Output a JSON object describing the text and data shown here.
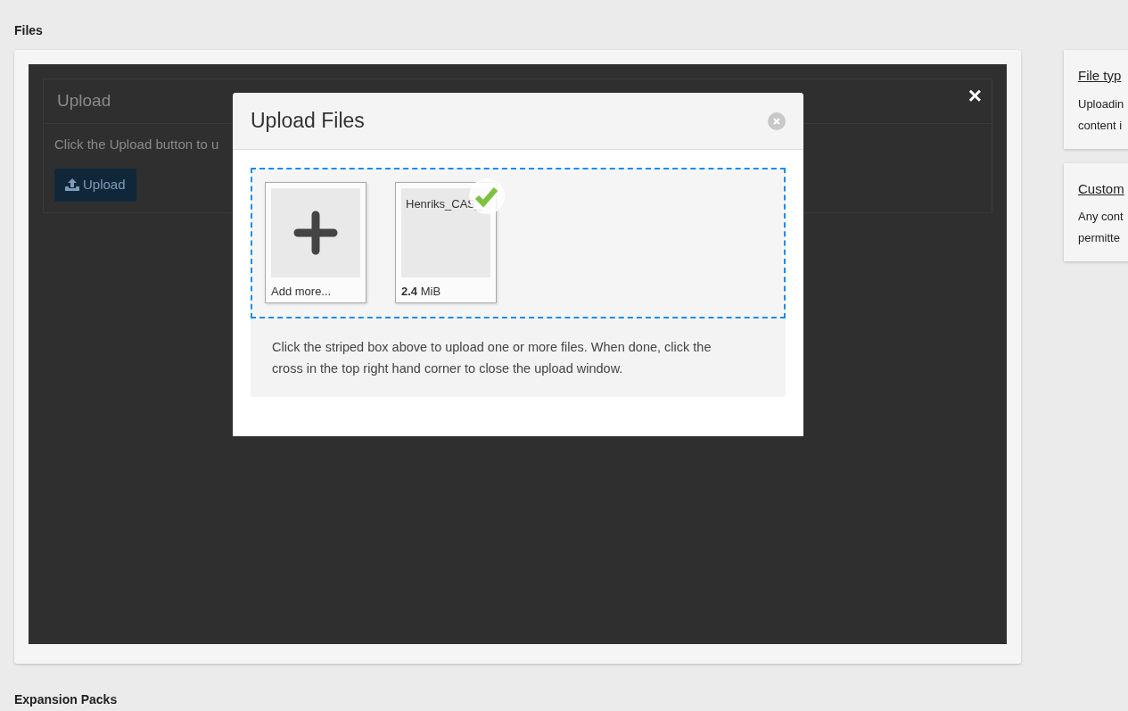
{
  "sections": [
    {
      "heading": "Files"
    },
    {
      "heading": "Expansion Packs"
    }
  ],
  "upload_panel": {
    "title": "Upload",
    "text": "Click the Upload button to u",
    "button": "Upload"
  },
  "overlay": {
    "close": "×"
  },
  "modal": {
    "title": "Upload Files",
    "tiles": [
      {
        "kind": "add",
        "label": "Add more..."
      },
      {
        "kind": "file",
        "name": "Henriks_CAS_",
        "size": "**2.4** MiB",
        "done": true
      }
    ],
    "info": "Click the striped box above to upload one or more files. When done, click the cross in the top right hand corner to close the upload window."
  },
  "side_cards": [
    {
      "title": "File typ",
      "lines": [
        "Uploadin",
        "content i"
      ]
    },
    {
      "title": "Custom",
      "lines": [
        "Any cont",
        "permitte"
      ]
    }
  ]
}
